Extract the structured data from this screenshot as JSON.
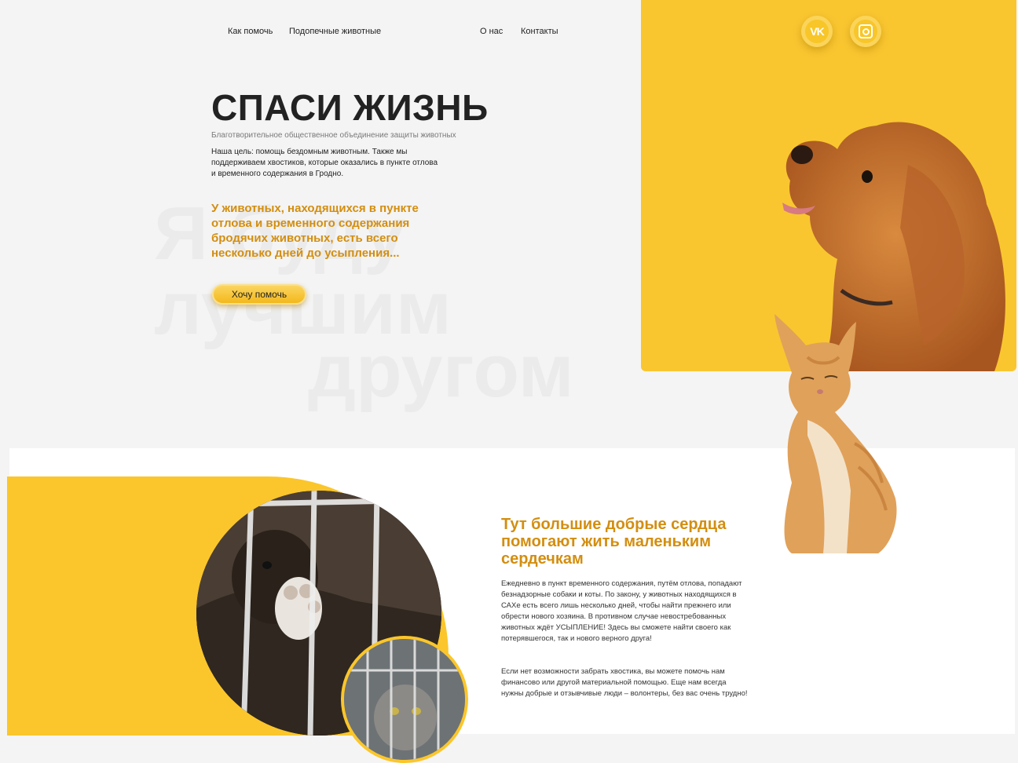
{
  "nav": {
    "items": [
      {
        "label": "Как помочь"
      },
      {
        "label": "Подопечные животные"
      },
      {
        "label": "О нас"
      },
      {
        "label": "Контакты"
      }
    ]
  },
  "social": {
    "vk": {
      "label": "VK",
      "icon": "vk-icon"
    },
    "instagram": {
      "icon": "instagram-icon"
    }
  },
  "hero": {
    "watermark_lines": [
      "Я буду",
      "лучшим",
      "другом"
    ],
    "title": "СПАСИ ЖИЗНЬ",
    "subtitle": "Благотворительное общественное объединение защиты животных",
    "goal": "Наша цель: помощь бездомным животным. Также мы поддерживаем хвостиков, которые оказались в пункте отлова и временного содержания в Гродно.",
    "warning": "У животных, находящихся в пункте отлова и временного содержания бродячих животных, есть всего несколько дней до усыпления...",
    "cta_label": "Хочу помочь"
  },
  "about": {
    "title": "Тут большие добрые сердца помогают жить маленьким сердечкам",
    "paragraph1": "Ежедневно в пункт временного содержания, путём отлова, попадают безнадзорные собаки и коты. По закону, у животных находящихся в САХе есть всего лишь несколько дней, чтобы найти прежнего или обрести нового хозяина. В противном случае невостребованных животных ждёт УСЫПЛЕНИЕ! Здесь вы сможете найти своего как потерявшегося, так и нового верного друга!",
    "paragraph2": "Если нет возможности забрать хвостика, вы можете помочь нам финансово или другой материальной помощью. Еще нам всегда нужны добрые и отзывчивые люди – волонтеры, без вас очень трудно!"
  },
  "colors": {
    "accent_yellow": "#f9c630",
    "accent_orange_text": "#d38e10",
    "page_bg": "#f4f4f4"
  }
}
